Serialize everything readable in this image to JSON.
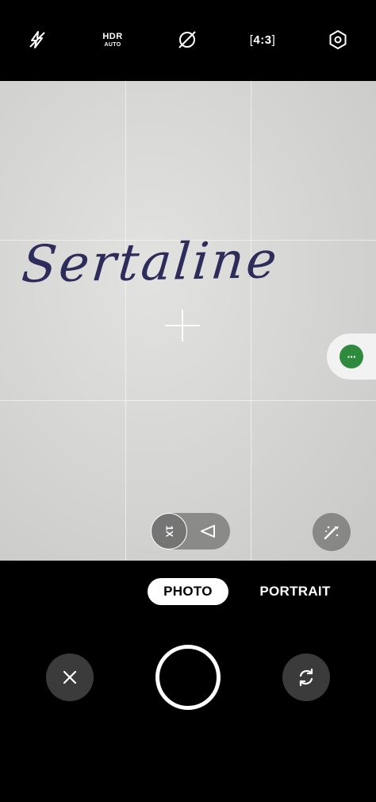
{
  "top_bar": {
    "flash_icon": "flash-off-icon",
    "hdr_label": "HDR",
    "hdr_sub_label": "AUTO",
    "filter_icon": "filter-off-icon",
    "aspect_ratio_label": "4:3",
    "settings_icon": "settings-hexagon-icon"
  },
  "viewfinder": {
    "handwritten_text": "Sertaline",
    "focus_icon": "focus-crosshair-icon",
    "floating_bubble_label": "···",
    "zoom_label": "1X",
    "wide_angle_icon": "wide-angle-icon",
    "magic_icon": "magic-wand-icon"
  },
  "modes": {
    "photo_label": "PHOTO",
    "portrait_label": "PORTRAIT"
  },
  "controls": {
    "close_icon": "close-icon",
    "shutter_icon": "shutter-icon",
    "switch_camera_icon": "switch-camera-icon"
  },
  "colors": {
    "bubble_green": "#2e8b3d",
    "ink": "#2e2c5a"
  }
}
